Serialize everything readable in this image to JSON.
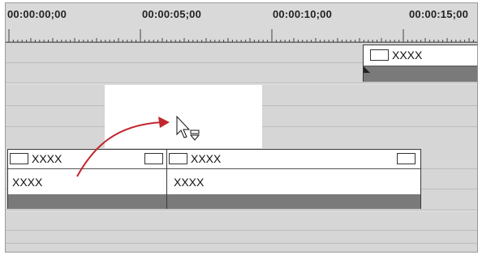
{
  "ruler": {
    "timecodes": [
      "00:00:00;00",
      "00:00:05;00",
      "00:00:10;00",
      "00:00:15;00"
    ]
  },
  "clips": {
    "top_clip": {
      "name": "XXXX"
    },
    "clip_a": {
      "name": "XXXX",
      "sub_name": "XXXX"
    },
    "clip_b": {
      "name": "XXXX",
      "sub_name": "XXXX"
    }
  },
  "icons": {
    "drag_cursor": "insert-cursor-icon",
    "arrow": "drag-path-arrow"
  },
  "colors": {
    "arrow": "#c0262d",
    "clip_footer": "#7a7a7a",
    "track_bg": "#d6d6d6"
  }
}
